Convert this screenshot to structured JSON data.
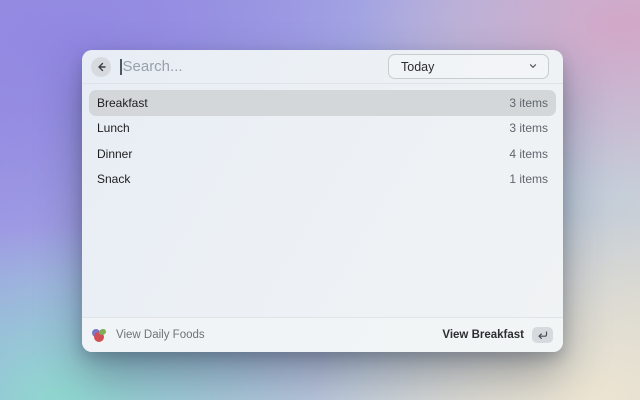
{
  "window": {
    "search": {
      "placeholder": "Search...",
      "value": ""
    },
    "filter_dropdown": {
      "selected_option": "Today"
    },
    "list": [
      {
        "label": "Breakfast",
        "count": "3 items",
        "selected": true
      },
      {
        "label": "Lunch",
        "count": "3 items",
        "selected": false
      },
      {
        "label": "Dinner",
        "count": "4 items",
        "selected": false
      },
      {
        "label": "Snack",
        "count": "1 items",
        "selected": false
      }
    ],
    "footer": {
      "app_label": "View Daily Foods",
      "action_label": "View Breakfast"
    }
  },
  "icons": {
    "back": "back-arrow-icon",
    "dropdown": "chevron-down-icon",
    "footer_app": "daily-foods-app-icon",
    "action_key": "return-key-icon"
  },
  "colors": {
    "row_highlight": "#d3d7da",
    "window_bg": "#edf1f5",
    "bg_purple": "#9187e2",
    "bg_pink": "#d3a7c7",
    "bg_teal": "#8fd8cf",
    "bg_cream": "#ece5d2",
    "text_primary": "#1d1d1f",
    "text_secondary": "#5f666d"
  }
}
